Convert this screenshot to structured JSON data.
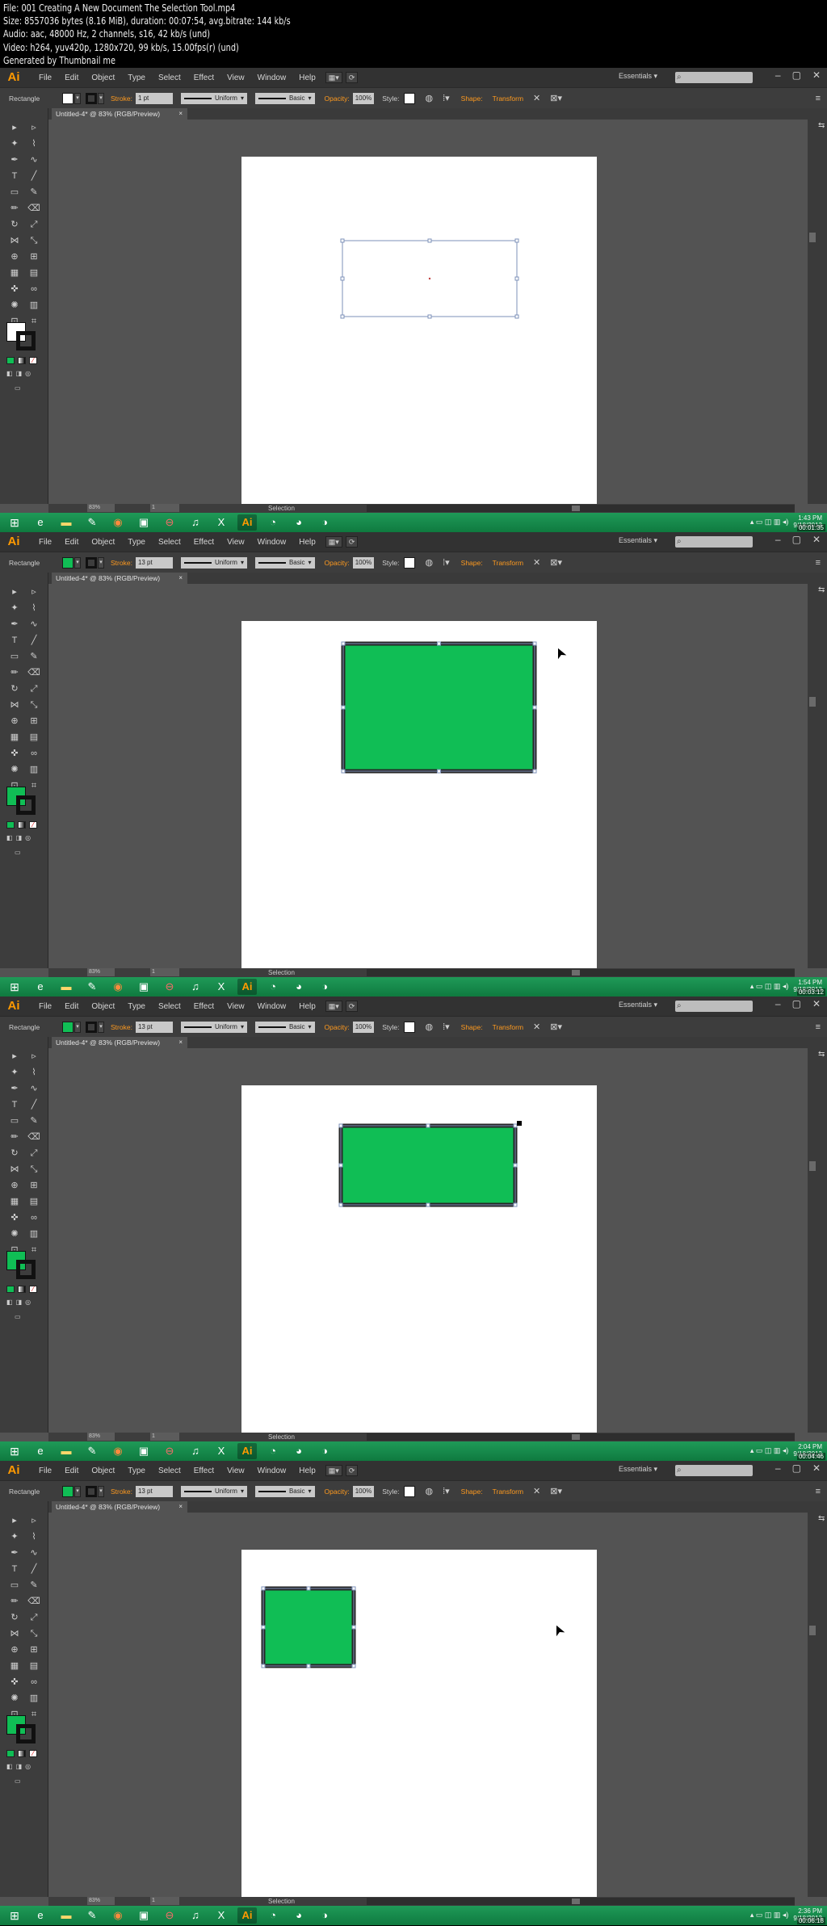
{
  "info": {
    "lines": [
      "File: 001 Creating A New Document  The Selection Tool.mp4",
      "Size: 8557036 bytes (8.16 MiB), duration: 00:07:54, avg.bitrate: 144 kb/s",
      "Audio: aac, 48000 Hz, 2 channels, s16, 42 kb/s (und)",
      "Video: h264, yuv420p, 1280x720, 99 kb/s, 15.00fps(r) (und)",
      "Generated by Thumbnail me"
    ]
  },
  "app": {
    "logo": "Ai",
    "menus": [
      "File",
      "Edit",
      "Object",
      "Type",
      "Select",
      "Effect",
      "View",
      "Window",
      "Help"
    ],
    "workspace": "Essentials",
    "window_controls": [
      "–",
      "▢",
      "✕"
    ]
  },
  "controlbar": {
    "tool_name": "Rectangle",
    "stroke_label": "Stroke:",
    "uniform_label": "Uniform",
    "basic_label": "Basic",
    "opacity_label": "Opacity:",
    "opacity_value": "100%",
    "style_label": "Style:",
    "shape_label": "Shape:",
    "transform_label": "Transform"
  },
  "document": {
    "tab_title": "Untitled-4* @ 83% (RGB/Preview)",
    "tab_close": "×"
  },
  "statusbar": {
    "zoom": "83%",
    "page": "1",
    "status": "Selection"
  },
  "colors": {
    "fill_green": "#10be55",
    "stroke_dark": "#262626",
    "bbox_blue": "#7e92b9",
    "taskbar_green": "#1a8f4e"
  },
  "tools": [
    "selection-tool",
    "direct-selection-tool",
    "magic-wand-tool",
    "lasso-tool",
    "pen-tool",
    "curvature-tool",
    "type-tool",
    "line-tool",
    "rectangle-tool",
    "paintbrush-tool",
    "pencil-tool",
    "eraser-tool",
    "rotate-tool",
    "scale-tool",
    "width-tool",
    "free-transform-tool",
    "shape-builder-tool",
    "perspective-tool",
    "mesh-tool",
    "gradient-tool",
    "eyedropper-tool",
    "blend-tool",
    "symbol-sprayer-tool",
    "column-graph-tool",
    "artboard-tool",
    "slice-tool",
    "hand-tool",
    "zoom-tool"
  ],
  "frames": [
    {
      "stroke_value": "1 pt",
      "fill_state": "white",
      "fill_color": "#ffffff",
      "selection": "outline-only",
      "clock_time": "1:43 PM",
      "clock_date": "9/18/2013",
      "timestamp": "00:01:35"
    },
    {
      "stroke_value": "13 pt",
      "fill_state": "green",
      "fill_color": "#10be55",
      "selection": "filled-stroked",
      "clock_time": "1:54 PM",
      "clock_date": "9/18/2013",
      "timestamp": "00:03:12"
    },
    {
      "stroke_value": "13 pt",
      "fill_state": "green",
      "fill_color": "#10be55",
      "selection": "filled-stroked-resizing",
      "clock_time": "2:04 PM",
      "clock_date": "9/18/2013",
      "timestamp": "00:04:46"
    },
    {
      "stroke_value": "13 pt",
      "fill_state": "green",
      "fill_color": "#10be55",
      "selection": "filled-stroked-moved",
      "clock_time": "2:36 PM",
      "clock_date": "9/18/2013",
      "timestamp": "00:06:18"
    }
  ]
}
